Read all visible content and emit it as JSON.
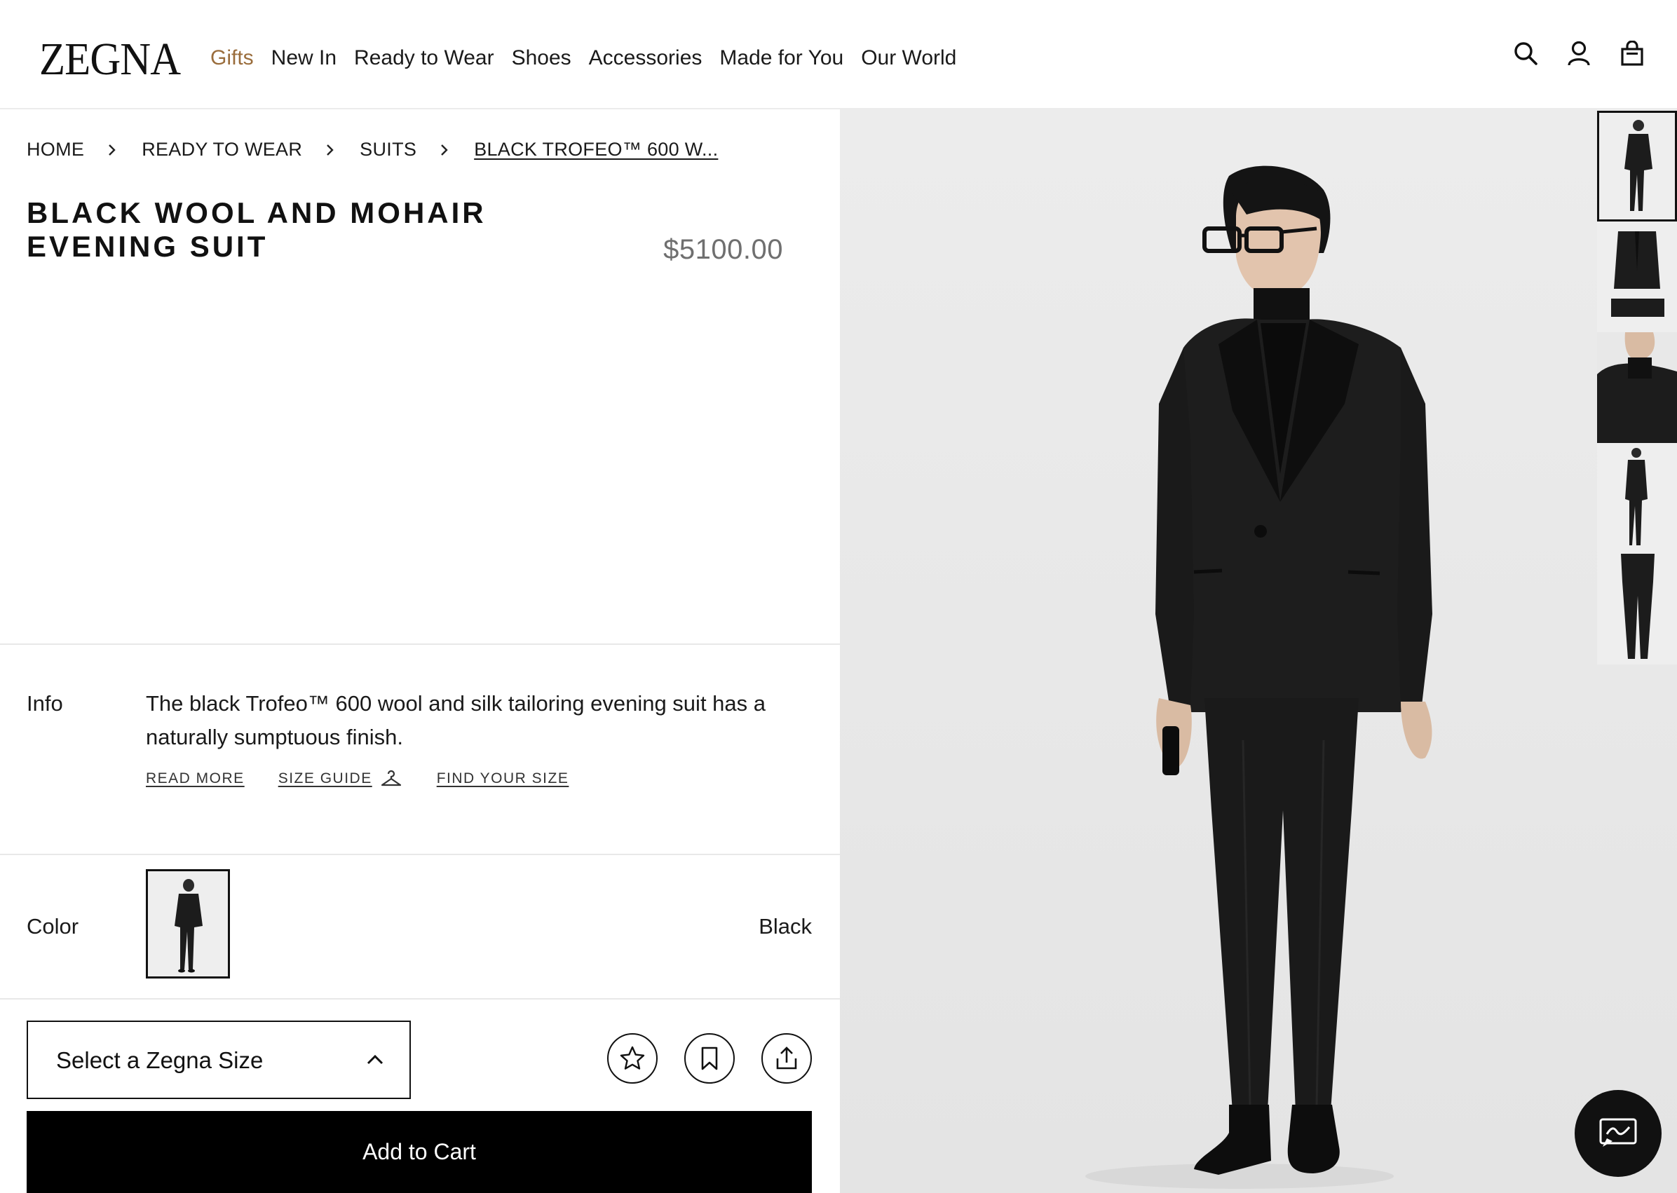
{
  "header": {
    "logo": "ZEGNA",
    "nav": [
      {
        "label": "Gifts",
        "accent": true
      },
      {
        "label": "New In"
      },
      {
        "label": "Ready to Wear"
      },
      {
        "label": "Shoes"
      },
      {
        "label": "Accessories"
      },
      {
        "label": "Made for You"
      },
      {
        "label": "Our World"
      }
    ],
    "icons": [
      "search-icon",
      "account-icon",
      "shopping-bag-icon"
    ]
  },
  "breadcrumb": [
    "HOME",
    "READY TO WEAR",
    "SUITS",
    "BLACK TROFEO™ 600 W..."
  ],
  "product": {
    "title": "BLACK WOOL AND MOHAIR EVENING SUIT",
    "price": "$5100.00",
    "info_label": "Info",
    "info_text": "The black Trofeo™ 600 wool and silk tailoring evening suit has a naturally sumptuous finish.",
    "links": {
      "read_more": "READ MORE",
      "size_guide": "SIZE GUIDE",
      "find_size": "FIND YOUR SIZE"
    },
    "color_label": "Color",
    "color_value": "Black",
    "size_select": "Select a Zegna Size",
    "add_to_cart": "Add to Cart"
  },
  "actions": [
    "star-icon",
    "bookmark-icon",
    "share-icon"
  ],
  "colors": {
    "accent": "#9a6d3c",
    "suit": "#1c1c1c",
    "background": "#ececec"
  }
}
